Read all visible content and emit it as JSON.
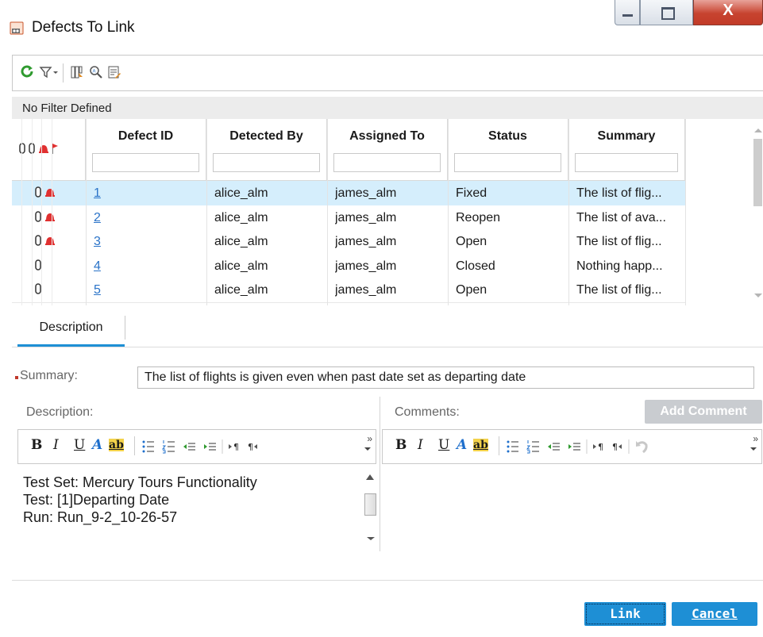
{
  "window": {
    "title": "Defects To Link"
  },
  "toolbar": {
    "icons": [
      "refresh-icon",
      "filter-icon",
      "select-columns-icon",
      "find-icon",
      "text-search-icon"
    ]
  },
  "filter_status": "No Filter Defined",
  "grid": {
    "columns": [
      "Defect ID",
      "Detected By",
      "Assigned To",
      "Status",
      "Summary"
    ],
    "rows": [
      {
        "id": "1",
        "detected_by": "alice_alm",
        "assigned_to": "james_alm",
        "status": "Fixed",
        "summary": "The list of flig...",
        "attachment": true,
        "alert": true,
        "selected": true
      },
      {
        "id": "2",
        "detected_by": "alice_alm",
        "assigned_to": "james_alm",
        "status": "Reopen",
        "summary": "The list of ava...",
        "attachment": true,
        "alert": true,
        "selected": false
      },
      {
        "id": "3",
        "detected_by": "alice_alm",
        "assigned_to": "james_alm",
        "status": "Open",
        "summary": "The list of flig...",
        "attachment": true,
        "alert": true,
        "selected": false
      },
      {
        "id": "4",
        "detected_by": "alice_alm",
        "assigned_to": "james_alm",
        "status": "Closed",
        "summary": "Nothing happ...",
        "attachment": true,
        "alert": false,
        "selected": false
      },
      {
        "id": "5",
        "detected_by": "alice_alm",
        "assigned_to": "james_alm",
        "status": "Open",
        "summary": "The list of flig...",
        "attachment": true,
        "alert": false,
        "selected": false
      }
    ]
  },
  "tabs": [
    {
      "label": "Description",
      "active": true
    }
  ],
  "details": {
    "summary_label": "Summary:",
    "summary_value": "The list of flights is given even when past date set as departing date",
    "description_label": "Description:",
    "comments_label": "Comments:",
    "add_comment_label": "Add Comment",
    "description_lines": [
      "Test Set: Mercury Tours Functionality",
      "Test: [1]Departing Date",
      "Run: Run_9-2_10-26-57"
    ]
  },
  "rte": {
    "bold": "B",
    "italic": "I",
    "underline": "U",
    "font_color": "A",
    "highlight": "ab",
    "more": "»"
  },
  "footer": {
    "link_label": "Link",
    "cancel_label": "Cancel"
  },
  "colors": {
    "accent": "#1e8fd5",
    "selected_row": "#d5eefc",
    "link": "#2a73c8",
    "alert": "#e03030"
  }
}
